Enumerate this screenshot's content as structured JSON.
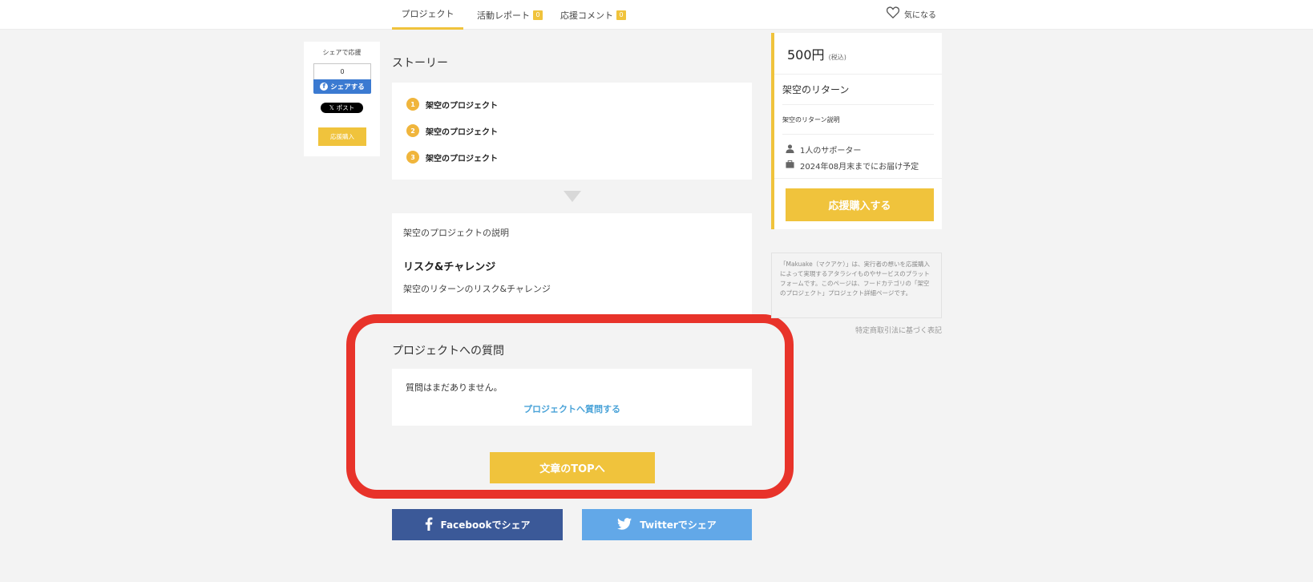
{
  "nav": {
    "tabs": [
      {
        "label": "プロジェクト"
      },
      {
        "label": "活動レポート",
        "count": "0"
      },
      {
        "label": "応援コメント",
        "count": "0"
      }
    ],
    "favorite_label": "気になる"
  },
  "side_share": {
    "title": "シェアで応援",
    "fb_count": "0",
    "fb_label": "シェアする",
    "x_label": "ポスト",
    "buy_label": "応援購入"
  },
  "story": {
    "heading": "ストーリー",
    "items": [
      {
        "num": "1",
        "label": "架空のプロジェクト"
      },
      {
        "num": "2",
        "label": "架空のプロジェクト"
      },
      {
        "num": "3",
        "label": "架空のプロジェクト"
      }
    ],
    "description": "架空のプロジェクトの説明",
    "risk_heading": "リスク&チャレンジ",
    "risk_text": "架空のリターンのリスク&チャレンジ"
  },
  "questions": {
    "heading": "プロジェクトへの質問",
    "empty_text": "質問はまだありません。",
    "ask_link": "プロジェクトへ質問する",
    "top_button": "文章のTOPへ"
  },
  "bottom_share": {
    "facebook": "Facebookでシェア",
    "twitter": "Twitterでシェア"
  },
  "return_card": {
    "price": "500円",
    "tax": "(税込)",
    "name": "架空のリターン",
    "description": "架空のリターン説明",
    "supporters": "1人のサポーター",
    "delivery": "2024年08月末までにお届け予定",
    "buy_button": "応援購入する"
  },
  "about_text": "「Makuake（マクアケ）」は、実行者の想いを応援購入によって実現するアタラシイものやサービスのプラットフォームです。このページは、フードカテゴリの「架空のプロジェクト」プロジェクト詳細ページです。",
  "tokusho_link": "特定商取引法に基づく表記",
  "colors": {
    "accent": "#f0c33c",
    "highlight": "#e8332a",
    "facebook": "#3b5998",
    "twitter": "#62a8e8",
    "link": "#4aa3d8"
  }
}
